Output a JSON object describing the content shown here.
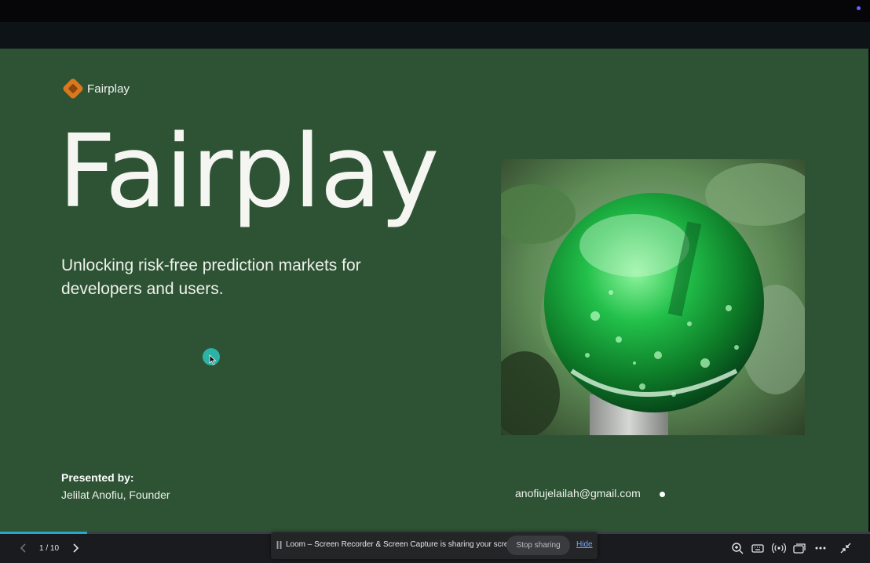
{
  "slide": {
    "logo_text": "Fairplay",
    "title": "Fairplay",
    "subtitle": "Unlocking risk-free prediction markets for developers and users.",
    "presented_by_label": "Presented by:",
    "presenter": "Jelilat Anofiu, Founder",
    "email": "anofiujelailah@gmail.com",
    "colors": {
      "background": "#2e5334",
      "logo_orange": "#d9781c",
      "text": "#f5f6f2"
    }
  },
  "viewer": {
    "page_counter": "1 / 10",
    "progress": 0.1,
    "icons": [
      "chevron-left-icon",
      "chevron-right-icon",
      "zoom-in-icon",
      "keyboard-icon",
      "broadcast-icon",
      "captions-icon",
      "more-icon",
      "exit-fullscreen-icon"
    ]
  },
  "share_notice": {
    "text": "Loom – Screen Recorder & Screen Capture is sharing your screen.",
    "stop_label": "Stop sharing",
    "hide_label": "Hide"
  }
}
